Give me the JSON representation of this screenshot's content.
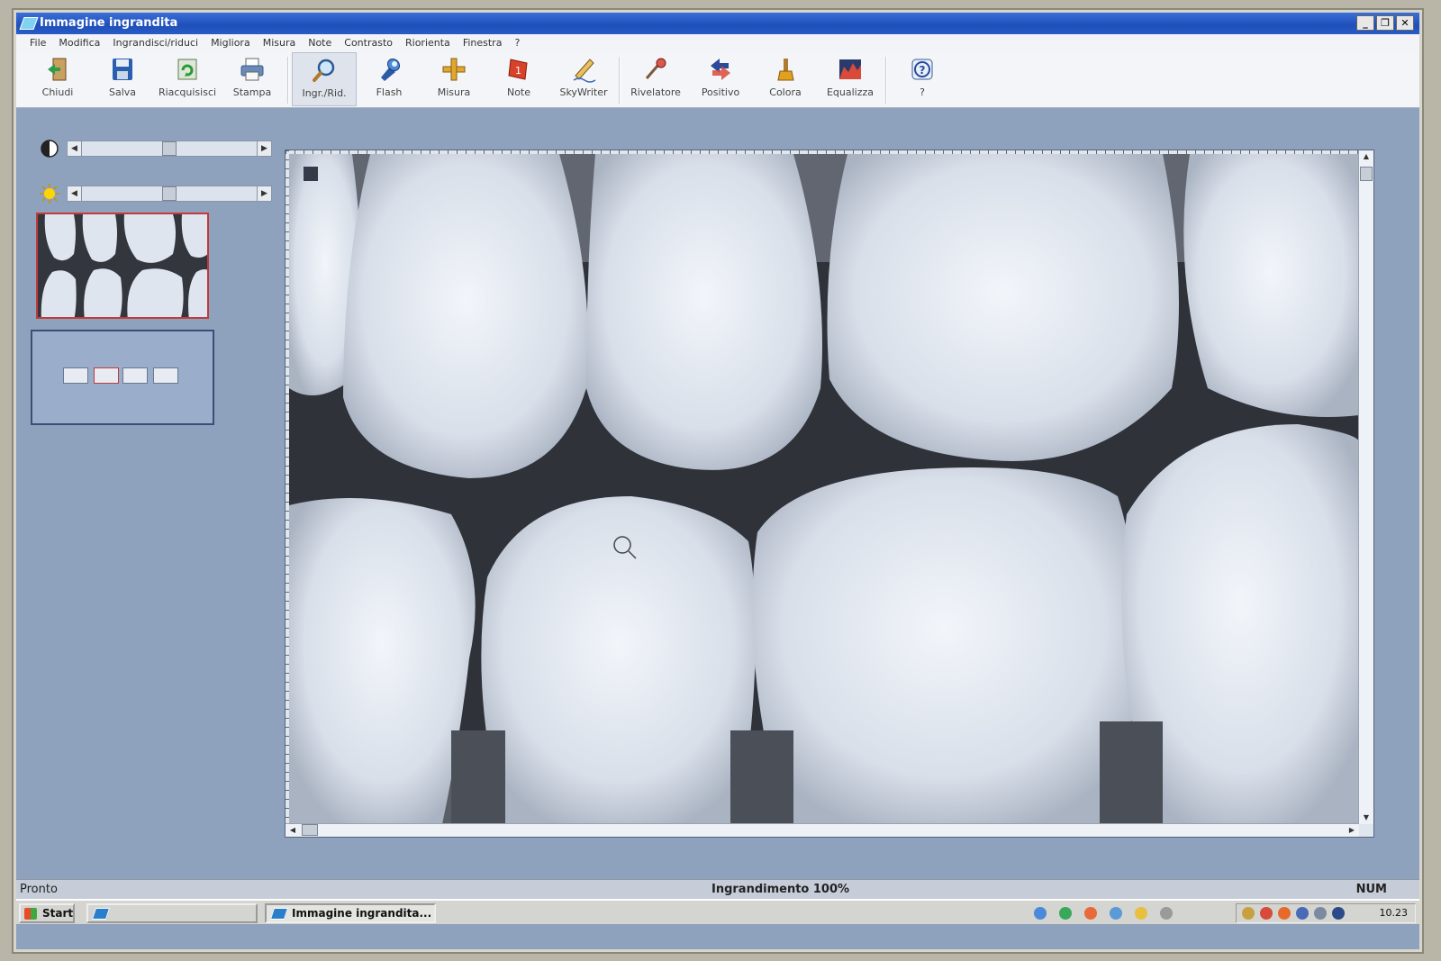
{
  "window": {
    "title": "Immagine ingrandita"
  },
  "menu": [
    "File",
    "Modifica",
    "Ingrandisci/riduci",
    "Migliora",
    "Misura",
    "Note",
    "Contrasto",
    "Riorienta",
    "Finestra",
    "?"
  ],
  "toolbar": {
    "chiudi": "Chiudi",
    "salva": "Salva",
    "riacquisisci": "Riacquisisci",
    "stampa": "Stampa",
    "ingr_rid": "Ingr./Rid.",
    "flash": "Flash",
    "misura": "Misura",
    "note": "Note",
    "skywriter": "SkyWriter",
    "rivelatore": "Rivelatore",
    "positivo": "Positivo",
    "colora": "Colora",
    "equalizza": "Equalizza",
    "help": "?"
  },
  "left_panel": {
    "contrast_icon": "contrast-icon",
    "brightness_icon": "sun-icon",
    "contrast_level": 0.5,
    "brightness_level": 0.5
  },
  "status": {
    "left": "Pronto",
    "zoom": "Ingrandimento 100%",
    "num": "NUM"
  },
  "taskbar": {
    "start": "Start",
    "active_task": "Immagine ingrandita...",
    "clock": "10.23"
  },
  "colors": {
    "titlebar": "#1f4fb8",
    "workspace": "#8fa2bd",
    "thumb_border": "#c23a3a"
  }
}
